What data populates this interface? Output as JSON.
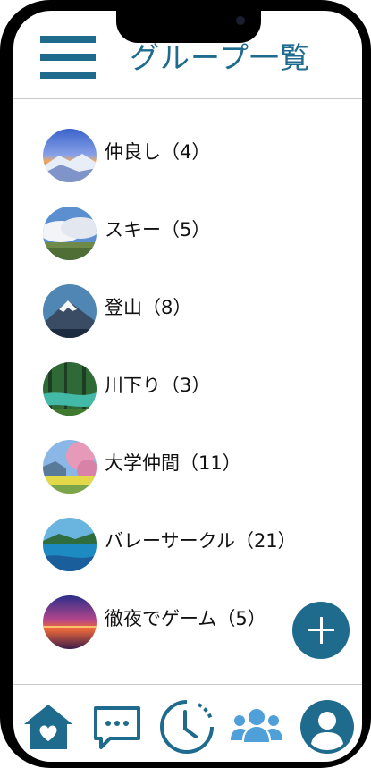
{
  "header": {
    "title": "グループ一覧"
  },
  "groups": [
    {
      "label": "仲良し（4）"
    },
    {
      "label": "スキー（5）"
    },
    {
      "label": "登山（8）"
    },
    {
      "label": "川下り（3）"
    },
    {
      "label": "大学仲間（11）"
    },
    {
      "label": "バレーサークル（21）"
    },
    {
      "label": "徹夜でゲーム（5）"
    }
  ],
  "colors": {
    "accent": "#1e6b8e",
    "tab_active": "#4f9fd8"
  },
  "icons": {
    "menu": "hamburger-icon",
    "add": "plus-icon",
    "tabs": [
      "home-heart-icon",
      "chat-icon",
      "clock-icon",
      "group-icon",
      "user-icon"
    ]
  }
}
